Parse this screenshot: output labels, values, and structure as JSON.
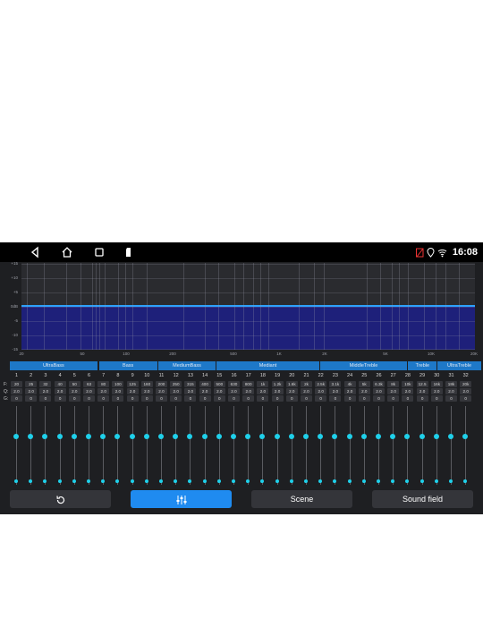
{
  "status": {
    "time": "16:08"
  },
  "graph": {
    "y_labels": [
      "+15",
      "+10",
      "+5",
      "0dB",
      "-5",
      "-10",
      "-15"
    ],
    "x_labels": [
      "20",
      "50",
      "100",
      "200",
      "500",
      "1K",
      "2K",
      "5K",
      "10K",
      "20K"
    ]
  },
  "groups": [
    "UltraBass",
    "Bass",
    "MediumBass",
    "Mediant",
    "MiddleTreble",
    "Treble",
    "UltraTreble"
  ],
  "table": {
    "row_labels": [
      "F:",
      "Q:",
      "G:"
    ],
    "bands": [
      "1",
      "2",
      "3",
      "4",
      "5",
      "6",
      "7",
      "8",
      "9",
      "10",
      "11",
      "12",
      "13",
      "14",
      "15",
      "16",
      "17",
      "18",
      "19",
      "20",
      "21",
      "22",
      "23",
      "24",
      "25",
      "26",
      "27",
      "28",
      "29",
      "30",
      "31",
      "32"
    ],
    "freq": [
      "20",
      "25",
      "32",
      "40",
      "50",
      "63",
      "80",
      "100",
      "125",
      "160",
      "200",
      "250",
      "315",
      "400",
      "500",
      "630",
      "800",
      "1k",
      "1.2k",
      "1.6k",
      "2k",
      "2.5k",
      "3.1k",
      "4k",
      "5k",
      "6.3k",
      "8k",
      "10k",
      "12.5",
      "16k",
      "18k",
      "20k"
    ],
    "q": [
      "2.0",
      "2.0",
      "2.0",
      "2.0",
      "2.0",
      "2.0",
      "2.0",
      "2.0",
      "2.0",
      "2.0",
      "2.0",
      "2.0",
      "2.0",
      "2.0",
      "2.0",
      "2.0",
      "2.0",
      "2.0",
      "2.0",
      "2.0",
      "2.0",
      "2.0",
      "2.0",
      "2.0",
      "2.0",
      "2.0",
      "2.0",
      "2.0",
      "2.0",
      "2.0",
      "2.0",
      "2.0"
    ],
    "gain": [
      "0",
      "0",
      "0",
      "0",
      "0",
      "0",
      "0",
      "0",
      "0",
      "0",
      "0",
      "0",
      "0",
      "0",
      "0",
      "0",
      "0",
      "0",
      "0",
      "0",
      "0",
      "0",
      "0",
      "0",
      "0",
      "0",
      "0",
      "0",
      "0",
      "0",
      "0",
      "0"
    ]
  },
  "buttons": {
    "reset_icon": "reset-icon",
    "eq_icon": "equalizer-icon",
    "scene": "Scene",
    "sound_field": "Sound field"
  },
  "colors": {
    "accent": "#1f8bf0",
    "knob": "#1fd0ea",
    "group": "#1e78c8",
    "curve_fill": "#1e207a"
  }
}
